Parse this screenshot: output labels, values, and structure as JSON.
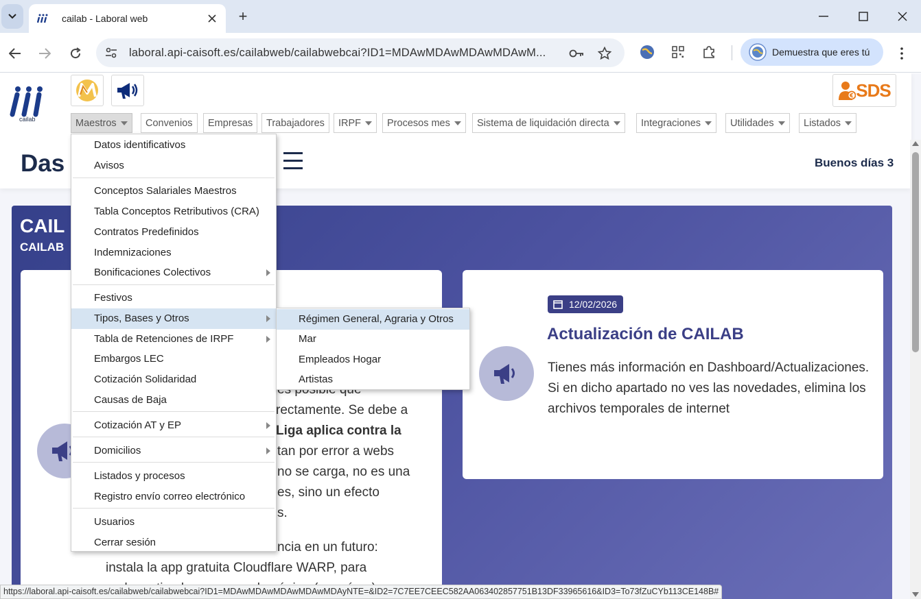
{
  "browser": {
    "tab_title": "cailab - Laboral web",
    "url": "laboral.api-caisoft.es/cailabweb/cailabwebcai?ID1=MDAwMDAwMDAwMDAwM...",
    "profile_label": "Demuestra que eres tú",
    "status_url": "https://laboral.api-caisoft.es/cailabweb/cailabwebcai?ID1=MDAwMDAwMDAwMDAwMDAyNTE=&ID2=7C7EE7CEEC582AA063402857751B13DF33965616&ID3=To73fZuCYb113CE148B#"
  },
  "header": {
    "logo_text": "cailab",
    "sds_label": "SDS",
    "page_title": "Das",
    "greeting": "Buenos días 3"
  },
  "menubar": [
    {
      "label": "Maestros",
      "has_caret": true
    },
    {
      "label": "Convenios",
      "has_caret": false
    },
    {
      "label": "Empresas",
      "has_caret": false
    },
    {
      "label": "Trabajadores",
      "has_caret": false
    },
    {
      "label": "IRPF",
      "has_caret": true
    },
    {
      "label": "Procesos mes",
      "has_caret": true
    },
    {
      "label": "Sistema de liquidación directa",
      "has_caret": true
    },
    {
      "label": "Integraciones",
      "has_caret": true
    },
    {
      "label": "Utilidades",
      "has_caret": true
    },
    {
      "label": "Listados",
      "has_caret": true
    }
  ],
  "dropdown": [
    "Datos identificativos",
    "Avisos",
    "Conceptos Salariales Maestros",
    "Tabla Conceptos Retributivos (CRA)",
    "Contratos Predefinidos",
    "Indemnizaciones",
    "Bonificaciones Colectivos",
    "Festivos",
    "Tipos, Bases y Otros",
    "Tabla de Retenciones de IRPF",
    "Embargos LEC",
    "Cotización Solidaridad",
    "Causas de Baja",
    "Cotización AT y EP",
    "Domicilios",
    "Listados y procesos",
    "Registro envío correo electrónico",
    "Usuarios",
    "Cerrar sesión"
  ],
  "submenu": [
    "Régimen General, Agraria y Otros",
    "Mar",
    "Empleados Hogar",
    "Artistas"
  ],
  "banner": {
    "title": "CAIL",
    "subtitle": "CAILAB"
  },
  "left_card": {
    "lines": [
      "es posible que",
      "rectamente. Se debe a",
      "Liga aplica contra la",
      "tan por error a webs",
      "no se carga, no es una",
      "es, sino un efecto",
      "s.",
      "ncia en un futuro:",
      "instala la app gratuita Cloudflare WARP, para",
      "poder activarla y recargar la página (ver cómo)"
    ]
  },
  "news_card": {
    "date": "12/02/2026",
    "title": "Actualización de CAILAB",
    "body": "Tienes más información en Dashboard/Actualizaciones. Si en dicho apartado no ves las novedades, elimina los archivos temporales de internet"
  },
  "colors": {
    "brand_navy": "#1c2b4b",
    "banner": "#4c52a0",
    "accent": "#3b3f86",
    "sds_orange": "#e87a1a",
    "menu_highlight": "#d6e4f2"
  }
}
